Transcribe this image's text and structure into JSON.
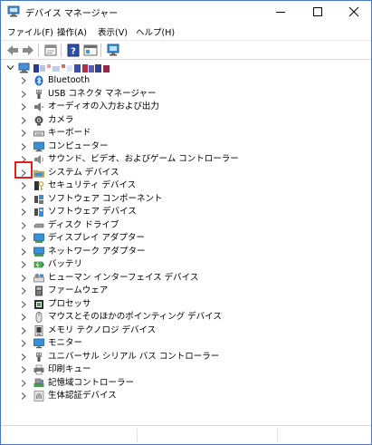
{
  "window": {
    "title": "デバイス マネージャー"
  },
  "menu": {
    "items": [
      "ファイル(F)",
      "操作(A)",
      "表示(V)",
      "ヘルプ(H)"
    ]
  },
  "toolbar": {
    "buttons": [
      "back-arrow-icon",
      "forward-arrow-icon",
      "properties-icon",
      "help-icon",
      "device-view-icon",
      "monitor-scan-icon"
    ]
  },
  "tree": {
    "root_label": "",
    "items": [
      {
        "label": "Bluetooth",
        "icon": "bluetooth-icon"
      },
      {
        "label": "USB コネクタ マネージャー",
        "icon": "usb-icon"
      },
      {
        "label": "オーディオの入力および出力",
        "icon": "speaker-icon"
      },
      {
        "label": "カメラ",
        "icon": "camera-icon"
      },
      {
        "label": "キーボード",
        "icon": "keyboard-icon"
      },
      {
        "label": "コンピューター",
        "icon": "computer-icon"
      },
      {
        "label": "サウンド、ビデオ、およびゲーム コントローラー",
        "icon": "sound-icon"
      },
      {
        "label": "システム デバイス",
        "icon": "system-folder-icon"
      },
      {
        "label": "セキュリティ デバイス",
        "icon": "security-key-icon"
      },
      {
        "label": "ソフトウェア コンポーネント",
        "icon": "software-component-icon"
      },
      {
        "label": "ソフトウェア デバイス",
        "icon": "software-device-icon"
      },
      {
        "label": "ディスク ドライブ",
        "icon": "disk-drive-icon"
      },
      {
        "label": "ディスプレイ アダプター",
        "icon": "display-adapter-icon"
      },
      {
        "label": "ネットワーク アダプター",
        "icon": "network-adapter-icon"
      },
      {
        "label": "バッテリ",
        "icon": "battery-icon"
      },
      {
        "label": "ヒューマン インターフェイス デバイス",
        "icon": "hid-icon"
      },
      {
        "label": "ファームウェア",
        "icon": "firmware-icon"
      },
      {
        "label": "プロセッサ",
        "icon": "processor-icon"
      },
      {
        "label": "マウスとそのほかのポインティング デバイス",
        "icon": "mouse-icon"
      },
      {
        "label": "メモリ テクノロジ デバイス",
        "icon": "memory-icon"
      },
      {
        "label": "モニター",
        "icon": "monitor-icon"
      },
      {
        "label": "ユニバーサル シリアル バス コントローラー",
        "icon": "usb-controller-icon"
      },
      {
        "label": "印刷キュー",
        "icon": "printer-icon"
      },
      {
        "label": "記憶域コントローラー",
        "icon": "storage-controller-icon"
      },
      {
        "label": "生体認証デバイス",
        "icon": "biometric-icon"
      }
    ]
  },
  "colors": {
    "highlight": "#e0201c",
    "window_border": "#4a7ab8"
  }
}
